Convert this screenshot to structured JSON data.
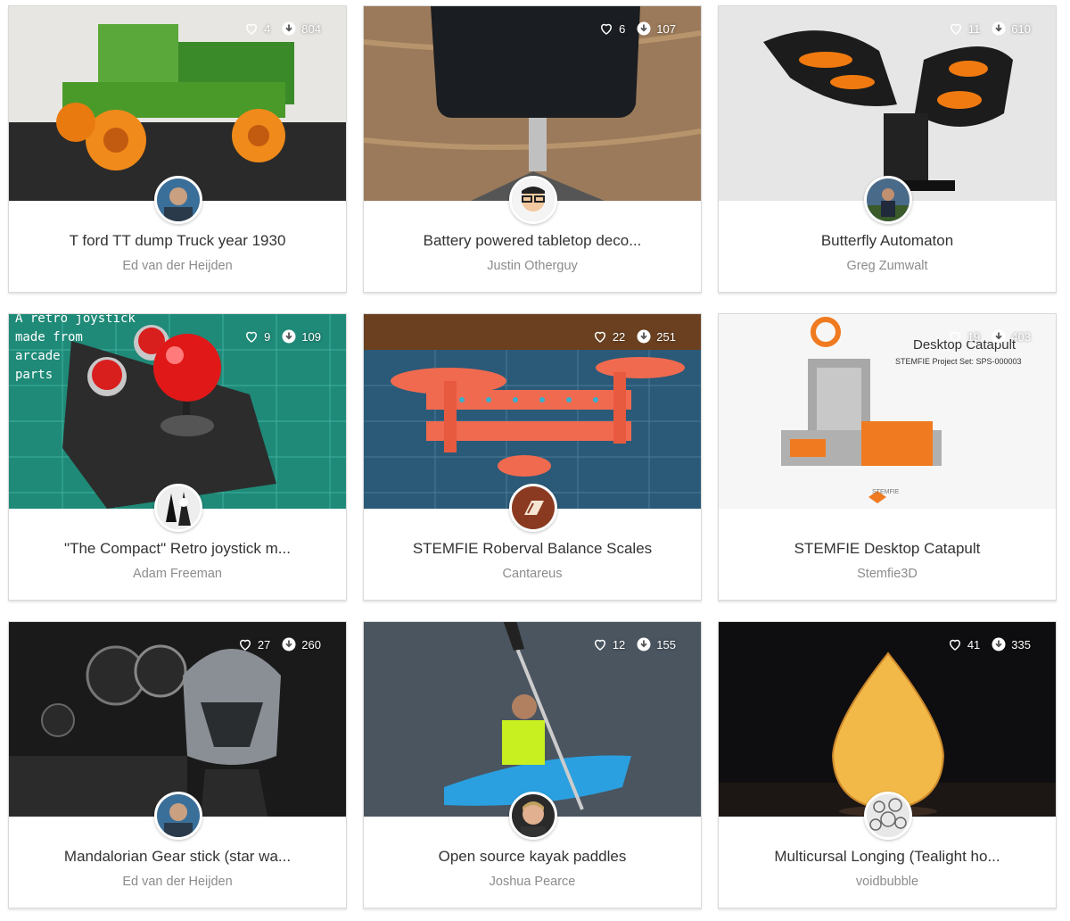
{
  "cards": [
    {
      "title": "T ford TT dump Truck year 1930",
      "author": "Ed van der Heijden",
      "likes": "4",
      "downloads": "804"
    },
    {
      "title": "Battery powered tabletop deco...",
      "author": "Justin Otherguy",
      "likes": "6",
      "downloads": "107"
    },
    {
      "title": "Butterfly Automaton",
      "author": "Greg Zumwalt",
      "likes": "11",
      "downloads": "610"
    },
    {
      "title": "\"The Compact\" Retro joystick m...",
      "author": "Adam Freeman",
      "likes": "9",
      "downloads": "109",
      "image_text": [
        "A retro joystick",
        "made from",
        "arcade",
        "parts"
      ]
    },
    {
      "title": "STEMFIE Roberval Balance Scales",
      "author": "Cantareus",
      "likes": "22",
      "downloads": "251"
    },
    {
      "title": "STEMFIE Desktop Catapult",
      "author": "Stemfie3D",
      "likes": "19",
      "downloads": "403",
      "image_text": [
        "Desktop Catapult",
        "STEMFIE Project Set: SPS-000003",
        "STEMFIE"
      ]
    },
    {
      "title": "Mandalorian Gear stick (star wa...",
      "author": "Ed van der Heijden",
      "likes": "27",
      "downloads": "260"
    },
    {
      "title": "Open source kayak paddles",
      "author": "Joshua Pearce",
      "likes": "12",
      "downloads": "155"
    },
    {
      "title": "Multicursal Longing (Tealight ho...",
      "author": "voidbubble",
      "likes": "41",
      "downloads": "335"
    }
  ],
  "icons": {
    "like": "heart-outline-icon",
    "download": "download-circle-icon"
  }
}
